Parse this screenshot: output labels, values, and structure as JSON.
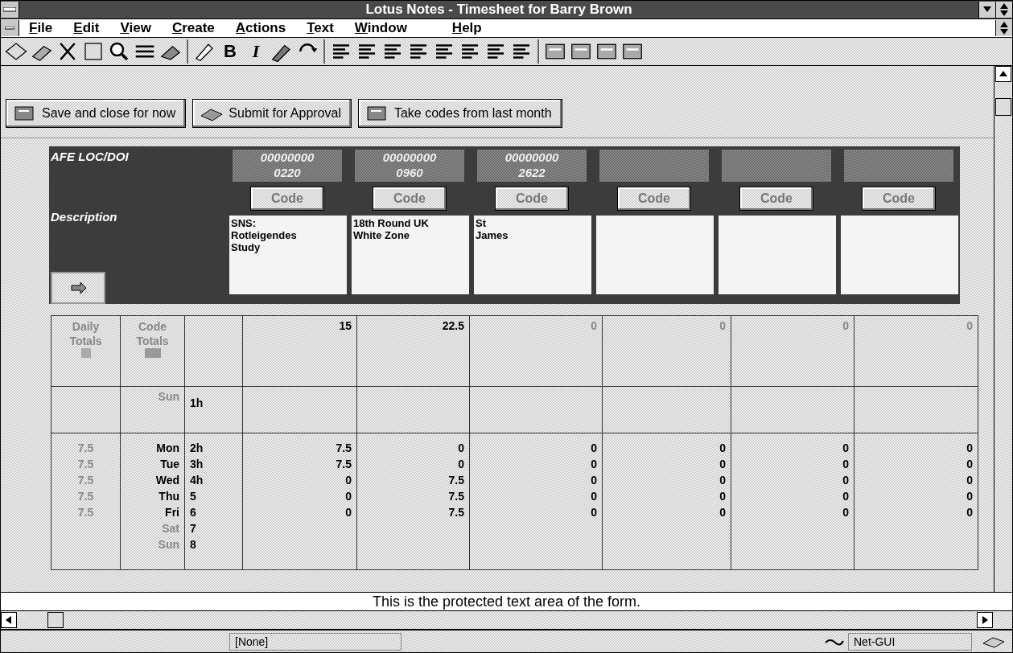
{
  "window": {
    "title": "Lotus Notes - Timesheet for Barry Brown"
  },
  "menu": [
    {
      "label": "File"
    },
    {
      "label": "Edit"
    },
    {
      "label": "View"
    },
    {
      "label": "Create"
    },
    {
      "label": "Actions"
    },
    {
      "label": "Text"
    },
    {
      "label": "Window"
    },
    {
      "label": "Help"
    }
  ],
  "toolbar": {
    "bold_label": "B",
    "italic_label": "I"
  },
  "action_buttons": [
    {
      "label": "Save and close for now"
    },
    {
      "label": "Submit for Approval"
    },
    {
      "label": "Take codes from last month"
    }
  ],
  "header": {
    "code_label": "AFE LOC/DOI",
    "description_label": "Description"
  },
  "columns": [
    {
      "code": "00000000\n0220",
      "button": "Code",
      "description": "SNS:\nRotleigendes\nStudy",
      "total": "15",
      "filled": true
    },
    {
      "code": "00000000\n0960",
      "button": "Code",
      "description": "18th Round UK\nWhite Zone",
      "total": "22.5",
      "filled": true
    },
    {
      "code": "00000000\n2622",
      "button": "Code",
      "description": "St\nJames",
      "total": "0",
      "filled": false
    },
    {
      "button": "Code",
      "total": "0",
      "filled": false
    },
    {
      "button": "Code",
      "total": "0",
      "filled": false
    },
    {
      "button": "Code",
      "total": "0",
      "filled": false
    }
  ],
  "table": {
    "daily_totals_label": "Daily Totals",
    "code_totals_label": "Code Totals",
    "first_row": {
      "day": "Sun",
      "hour": "1h"
    },
    "days": [
      {
        "day": "Mon",
        "hour": "2h",
        "daily": "7.5",
        "weekend": false,
        "values": [
          "7.5",
          "0",
          "0",
          "0",
          "0",
          "0"
        ]
      },
      {
        "day": "Tue",
        "hour": "3h",
        "daily": "7.5",
        "weekend": false,
        "values": [
          "7.5",
          "0",
          "0",
          "0",
          "0",
          "0"
        ]
      },
      {
        "day": "Wed",
        "hour": "4h",
        "daily": "7.5",
        "weekend": false,
        "values": [
          "0",
          "7.5",
          "0",
          "0",
          "0",
          "0"
        ]
      },
      {
        "day": "Thu",
        "hour": "5",
        "daily": "7.5",
        "weekend": false,
        "values": [
          "0",
          "7.5",
          "0",
          "0",
          "0",
          "0"
        ]
      },
      {
        "day": "Fri",
        "hour": "6",
        "daily": "7.5",
        "weekend": false,
        "values": [
          "0",
          "7.5",
          "0",
          "0",
          "0",
          "0"
        ]
      },
      {
        "day": "Sat",
        "hour": "7",
        "weekend": true
      },
      {
        "day": "Sun",
        "hour": "8",
        "weekend": true
      }
    ]
  },
  "protected_text": "This is the protected text area of the form.",
  "status_bar": {
    "field_2": "[None]",
    "server": "Net-GUI"
  }
}
